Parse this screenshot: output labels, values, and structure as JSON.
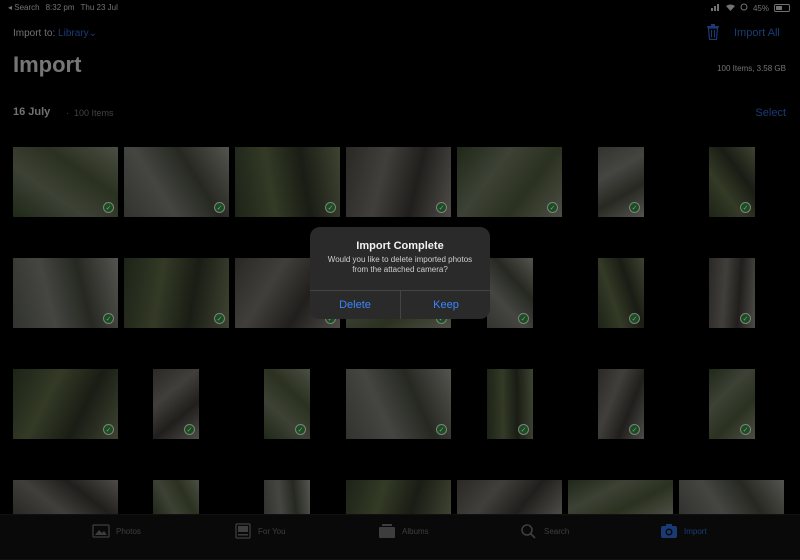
{
  "status": {
    "back": "◂ Search",
    "time": "8:32 pm",
    "date": "Thu 23 Jul",
    "battery": "45%"
  },
  "header": {
    "import_to_label": "Import to:",
    "library": "Library",
    "import_all": "Import All",
    "title": "Import",
    "count": "100 Items, 3.58 GB"
  },
  "section": {
    "date": "16 July",
    "sep": "·",
    "items": "100 Items",
    "select": "Select"
  },
  "dialog": {
    "title": "Import Complete",
    "message": "Would you like to delete imported photos from the attached camera?",
    "delete": "Delete",
    "keep": "Keep"
  },
  "tabs": [
    {
      "label": "Photos"
    },
    {
      "label": "For You"
    },
    {
      "label": "Albums"
    },
    {
      "label": "Search"
    },
    {
      "label": "Import",
      "active": true
    }
  ],
  "colors": {
    "accent": "#2f6bd6",
    "check": "#2f8f3c"
  },
  "photo_check_mark": "✓"
}
